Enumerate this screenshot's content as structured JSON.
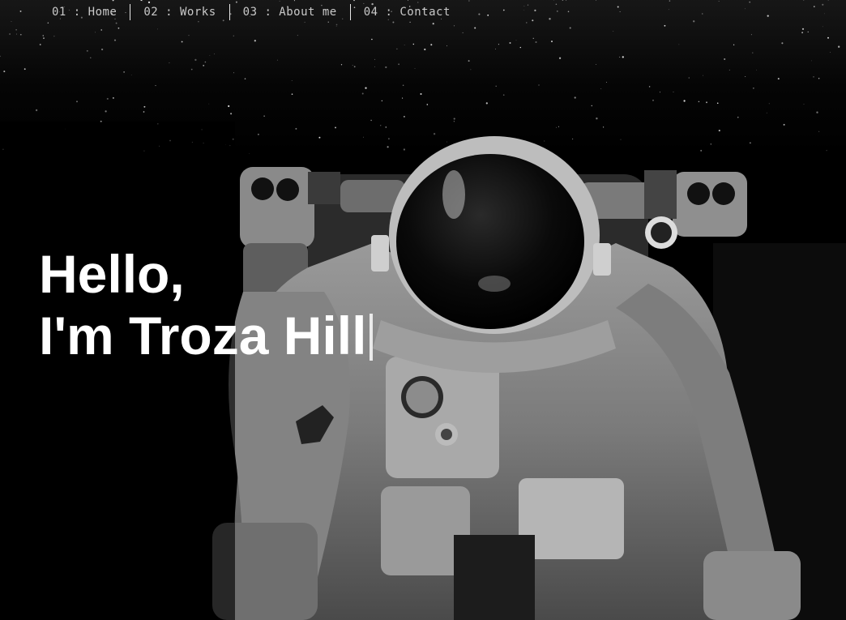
{
  "nav": {
    "items": [
      {
        "number": "01",
        "label": "Home",
        "text": "01 : Home"
      },
      {
        "number": "02",
        "label": "Works",
        "text": "02 : Works"
      },
      {
        "number": "03",
        "label": "About me",
        "text": "03 : About me"
      },
      {
        "number": "04",
        "label": "Contact",
        "text": "04 : Contact"
      }
    ]
  },
  "hero": {
    "greeting": "Hello,",
    "name_line": "I'm Troza Hill",
    "background_image": "astronaut-in-space",
    "colors": {
      "background": "#000000",
      "text": "#ffffff",
      "nav_text": "#c9c9c9"
    }
  }
}
